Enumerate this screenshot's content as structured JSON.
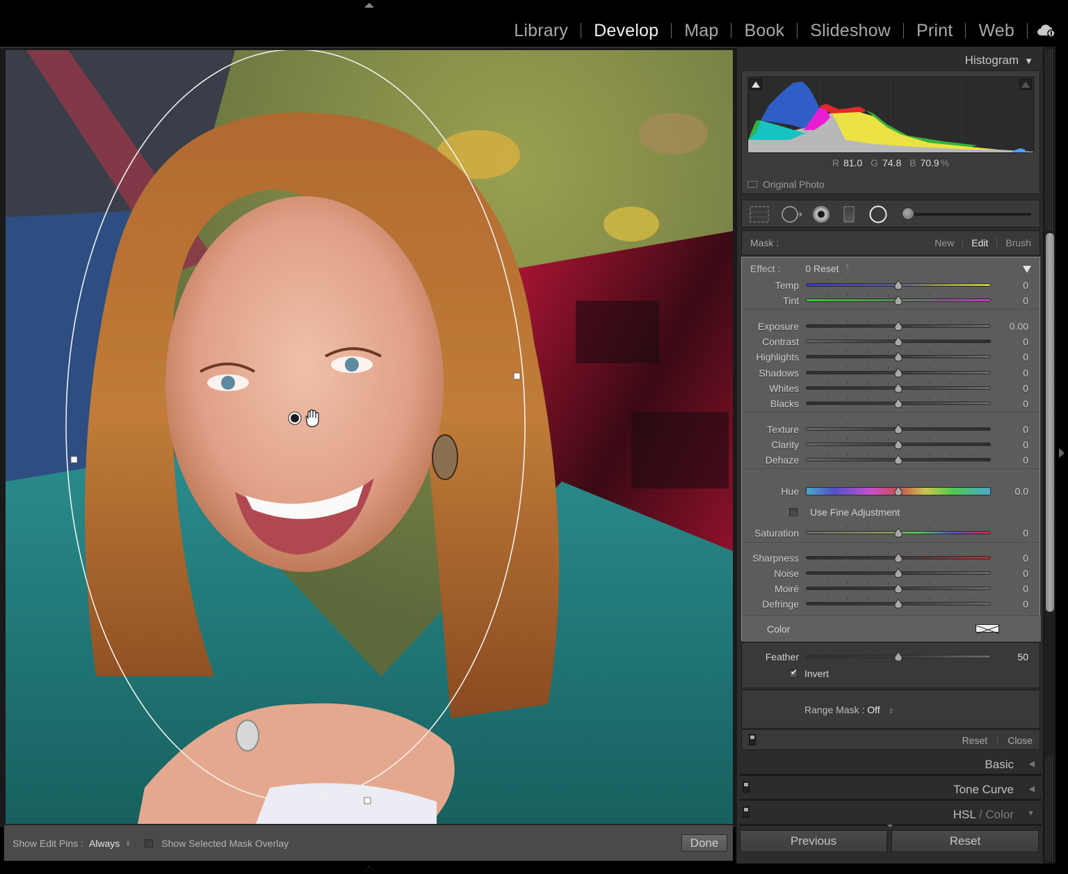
{
  "modules": [
    {
      "label": "Library",
      "active": false
    },
    {
      "label": "Develop",
      "active": true
    },
    {
      "label": "Map",
      "active": false
    },
    {
      "label": "Book",
      "active": false
    },
    {
      "label": "Slideshow",
      "active": false
    },
    {
      "label": "Print",
      "active": false
    },
    {
      "label": "Web",
      "active": false
    }
  ],
  "icons": {
    "cloud": "cloud-sync-icon",
    "top_collapse": "triangle-up-icon",
    "hand_cursor": "hand-cursor-icon"
  },
  "histogram": {
    "title": "Histogram",
    "readout": {
      "r_label": "R",
      "r": "81.0",
      "g_label": "G",
      "g": "74.8",
      "b_label": "B",
      "b": "70.9",
      "unit": "%"
    },
    "original_photo_label": "Original Photo",
    "colors": {
      "blue": "#2f5fc8",
      "cyan": "#17c3c3",
      "magenta": "#e81dd0",
      "red": "#e02a2a",
      "yellow": "#ece042",
      "green": "#33b43a",
      "gray": "#b4b4b4"
    }
  },
  "mask": {
    "label": "Mask :",
    "options": [
      {
        "label": "New",
        "active": false
      },
      {
        "label": "Edit",
        "active": true
      },
      {
        "label": "Brush",
        "active": false
      }
    ]
  },
  "effect": {
    "label": "Effect :",
    "preset": "0 Reset",
    "sliders": [
      {
        "label": "Temp",
        "value": "0",
        "position": 0.5,
        "gradient": "temp"
      },
      {
        "label": "Tint",
        "value": "0",
        "position": 0.5,
        "gradient": "tint"
      },
      {
        "label": "Exposure",
        "value": "0.00",
        "position": 0.5,
        "gradient": "dark-light"
      },
      {
        "label": "Contrast",
        "value": "0",
        "position": 0.5,
        "gradient": "light-dark"
      },
      {
        "label": "Highlights",
        "value": "0",
        "position": 0.5,
        "gradient": "dark-light"
      },
      {
        "label": "Shadows",
        "value": "0",
        "position": 0.5,
        "gradient": "dark-light"
      },
      {
        "label": "Whites",
        "value": "0",
        "position": 0.5,
        "gradient": "dark-light"
      },
      {
        "label": "Blacks",
        "value": "0",
        "position": 0.5,
        "gradient": "dark-light"
      },
      {
        "label": "Texture",
        "value": "0",
        "position": 0.5,
        "gradient": "light-dark"
      },
      {
        "label": "Clarity",
        "value": "0",
        "position": 0.5,
        "gradient": "light-dark"
      },
      {
        "label": "Dehaze",
        "value": "0",
        "position": 0.5,
        "gradient": "light-dark"
      },
      {
        "label": "Hue",
        "value": "0.0",
        "position": 0.5,
        "gradient": "hue"
      },
      {
        "label": "Saturation",
        "value": "0",
        "position": 0.5,
        "gradient": "saturation"
      },
      {
        "label": "Sharpness",
        "value": "0",
        "position": 0.5,
        "gradient": "sharpness"
      },
      {
        "label": "Noise",
        "value": "0",
        "position": 0.5,
        "gradient": "dark-light"
      },
      {
        "label": "Moiré",
        "value": "0",
        "position": 0.5,
        "gradient": "dark-light"
      },
      {
        "label": "Defringe",
        "value": "0",
        "position": 0.5,
        "gradient": "dark-light"
      }
    ],
    "fine_adjustment_label": "Use Fine Adjustment",
    "fine_adjustment_checked": false,
    "color_label": "Color"
  },
  "feather": {
    "label": "Feather",
    "value": "50",
    "position": 0.5
  },
  "invert": {
    "label": "Invert",
    "checked": true
  },
  "range_mask": {
    "label": "Range Mask :",
    "value": "Off"
  },
  "panel_actions": {
    "reset": "Reset",
    "close": "Close"
  },
  "sections": [
    {
      "title": "Basic",
      "title_dim": ""
    },
    {
      "title": "Tone Curve",
      "title_dim": ""
    },
    {
      "title": "HSL",
      "title_dim": "Color"
    }
  ],
  "bottom_buttons": {
    "previous": "Previous",
    "reset": "Reset"
  },
  "toolbar": {
    "show_edit_pins_label": "Show Edit Pins :",
    "show_edit_pins_value": "Always",
    "overlay_label": "Show Selected Mask Overlay",
    "overlay_checked": false,
    "done_label": "Done"
  }
}
